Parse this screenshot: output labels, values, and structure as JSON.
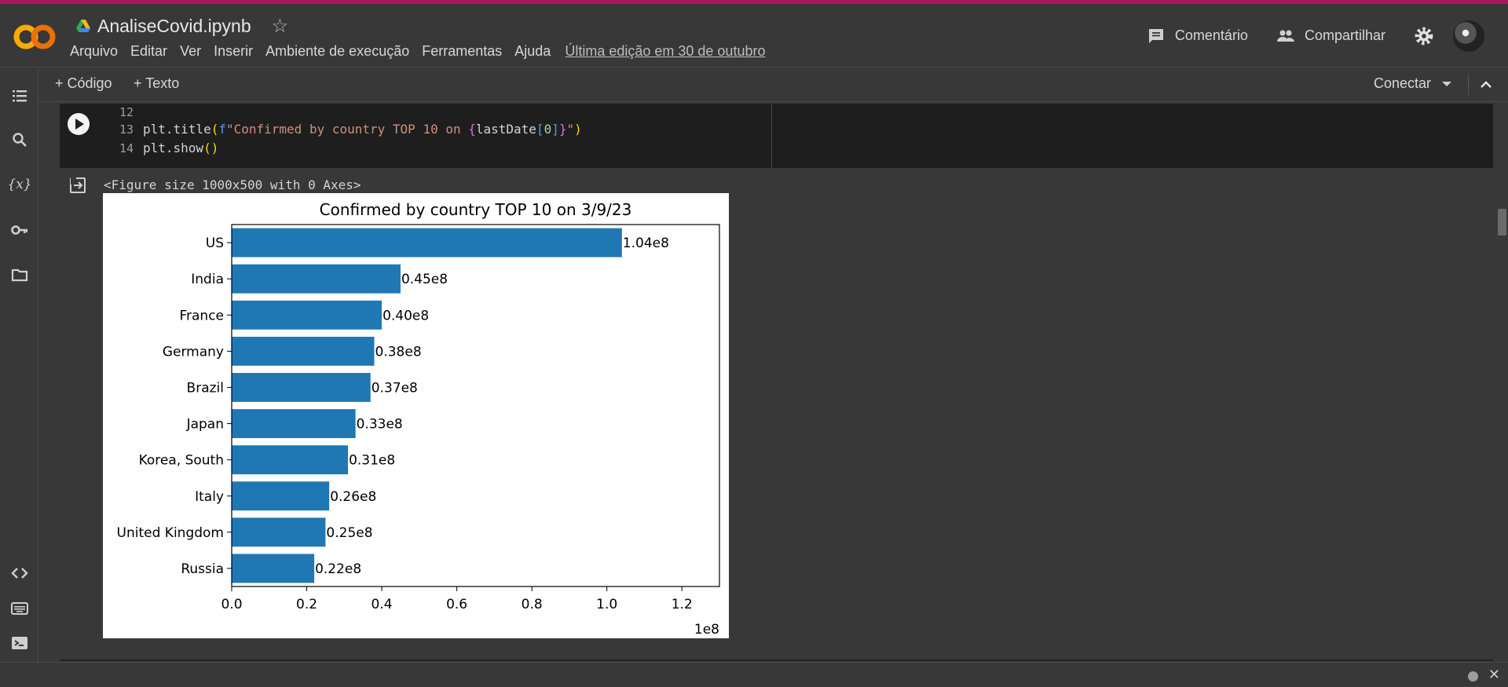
{
  "app": {
    "notebook_title": "AnaliseCovid.ipynb",
    "menu": [
      "Arquivo",
      "Editar",
      "Ver",
      "Inserir",
      "Ambiente de execução",
      "Ferramentas",
      "Ajuda"
    ],
    "last_edit": "Última edição em 30 de outubro",
    "comment_label": "Comentário",
    "share_label": "Compartilhar"
  },
  "toolbar": {
    "add_code": "+ Código",
    "add_text": "+ Texto",
    "connect": "Conectar"
  },
  "code_cell": {
    "lines": [
      {
        "num": "12",
        "code": ""
      },
      {
        "num": "13",
        "code": "plt.title(f\"Confirmed by country TOP 10 on {lastDate[0]}\")"
      },
      {
        "num": "14",
        "code": "plt.show()"
      }
    ]
  },
  "output": {
    "figure_text": "<Figure size 1000x500 with 0 Axes>"
  },
  "chart_data": {
    "type": "bar",
    "orientation": "horizontal",
    "title": "Confirmed by country TOP 10 on 3/9/23",
    "categories": [
      "US",
      "India",
      "France",
      "Germany",
      "Brazil",
      "Japan",
      "Korea, South",
      "Italy",
      "United Kingdom",
      "Russia"
    ],
    "values": [
      1.04,
      0.45,
      0.4,
      0.38,
      0.37,
      0.33,
      0.31,
      0.26,
      0.25,
      0.22
    ],
    "data_labels": [
      "1.04e8",
      "0.45e8",
      "0.40e8",
      "0.38e8",
      "0.37e8",
      "0.33e8",
      "0.31e8",
      "0.26e8",
      "0.25e8",
      "0.22e8"
    ],
    "xticks": [
      "0.0",
      "0.2",
      "0.4",
      "0.6",
      "0.8",
      "1.0",
      "1.2"
    ],
    "xtick_values": [
      0.0,
      0.2,
      0.4,
      0.6,
      0.8,
      1.0,
      1.2
    ],
    "x_scale_label": "1e8",
    "xlim": [
      0,
      1.3
    ],
    "bar_color": "#1f77b4",
    "grid": false,
    "xlabel": "",
    "ylabel": ""
  }
}
